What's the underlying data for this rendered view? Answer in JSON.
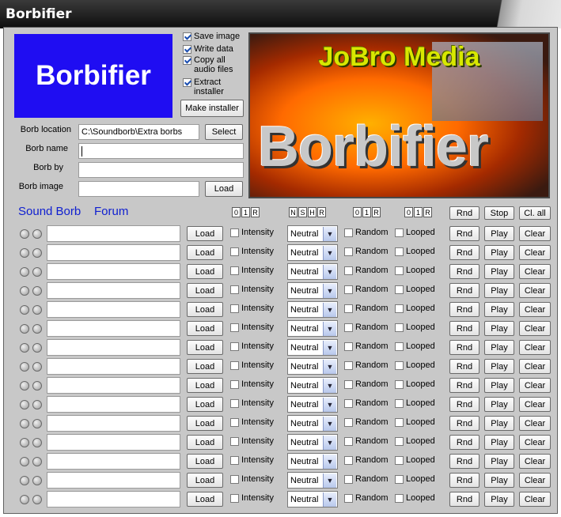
{
  "window": {
    "title": "Borbifier"
  },
  "logo": {
    "text": "Borbifier"
  },
  "options": {
    "save_image": {
      "label": "Save image",
      "checked": true
    },
    "write_data": {
      "label": "Write data",
      "checked": true
    },
    "copy_audio": {
      "label_1": "Copy all",
      "label_2": "audio files",
      "checked": true
    },
    "extract_installer": {
      "label_1": "Extract",
      "label_2": "installer",
      "checked": true
    },
    "make_installer": "Make installer"
  },
  "form": {
    "location_label": "Borb location",
    "location_value": "C:\\Soundborb\\Extra borbs",
    "select_button": "Select",
    "name_label": "Borb name",
    "name_value": "",
    "by_label": "Borb by",
    "by_value": "",
    "image_label": "Borb image",
    "image_value": "",
    "load_button": "Load"
  },
  "banner": {
    "company": "JoBro Media",
    "title": "Borbifier"
  },
  "links": {
    "sound_borb": "Sound Borb",
    "forum": "Forum"
  },
  "header": {
    "group1": [
      "0",
      "1",
      "R"
    ],
    "group2": [
      "N",
      "S",
      "H",
      "R"
    ],
    "group3": [
      "0",
      "1",
      "R"
    ],
    "group4": [
      "0",
      "1",
      "R"
    ],
    "rnd": "Rnd",
    "stop": "Stop",
    "clear_all": "Cl. all"
  },
  "rows": [
    {
      "load": "Load",
      "intensity": "Intensity",
      "mode": "Neutral",
      "random": "Random",
      "looped": "Looped",
      "rnd": "Rnd",
      "play": "Play",
      "clear": "Clear"
    },
    {
      "load": "Load",
      "intensity": "Intensity",
      "mode": "Neutral",
      "random": "Random",
      "looped": "Looped",
      "rnd": "Rnd",
      "play": "Play",
      "clear": "Clear"
    },
    {
      "load": "Load",
      "intensity": "Intensity",
      "mode": "Neutral",
      "random": "Random",
      "looped": "Looped",
      "rnd": "Rnd",
      "play": "Play",
      "clear": "Clear"
    },
    {
      "load": "Load",
      "intensity": "Intensity",
      "mode": "Neutral",
      "random": "Random",
      "looped": "Looped",
      "rnd": "Rnd",
      "play": "Play",
      "clear": "Clear"
    },
    {
      "load": "Load",
      "intensity": "Intensity",
      "mode": "Neutral",
      "random": "Random",
      "looped": "Looped",
      "rnd": "Rnd",
      "play": "Play",
      "clear": "Clear"
    },
    {
      "load": "Load",
      "intensity": "Intensity",
      "mode": "Neutral",
      "random": "Random",
      "looped": "Looped",
      "rnd": "Rnd",
      "play": "Play",
      "clear": "Clear"
    },
    {
      "load": "Load",
      "intensity": "Intensity",
      "mode": "Neutral",
      "random": "Random",
      "looped": "Looped",
      "rnd": "Rnd",
      "play": "Play",
      "clear": "Clear"
    },
    {
      "load": "Load",
      "intensity": "Intensity",
      "mode": "Neutral",
      "random": "Random",
      "looped": "Looped",
      "rnd": "Rnd",
      "play": "Play",
      "clear": "Clear"
    },
    {
      "load": "Load",
      "intensity": "Intensity",
      "mode": "Neutral",
      "random": "Random",
      "looped": "Looped",
      "rnd": "Rnd",
      "play": "Play",
      "clear": "Clear"
    },
    {
      "load": "Load",
      "intensity": "Intensity",
      "mode": "Neutral",
      "random": "Random",
      "looped": "Looped",
      "rnd": "Rnd",
      "play": "Play",
      "clear": "Clear"
    },
    {
      "load": "Load",
      "intensity": "Intensity",
      "mode": "Neutral",
      "random": "Random",
      "looped": "Looped",
      "rnd": "Rnd",
      "play": "Play",
      "clear": "Clear"
    },
    {
      "load": "Load",
      "intensity": "Intensity",
      "mode": "Neutral",
      "random": "Random",
      "looped": "Looped",
      "rnd": "Rnd",
      "play": "Play",
      "clear": "Clear"
    },
    {
      "load": "Load",
      "intensity": "Intensity",
      "mode": "Neutral",
      "random": "Random",
      "looped": "Looped",
      "rnd": "Rnd",
      "play": "Play",
      "clear": "Clear"
    },
    {
      "load": "Load",
      "intensity": "Intensity",
      "mode": "Neutral",
      "random": "Random",
      "looped": "Looped",
      "rnd": "Rnd",
      "play": "Play",
      "clear": "Clear"
    },
    {
      "load": "Load",
      "intensity": "Intensity",
      "mode": "Neutral",
      "random": "Random",
      "looped": "Looped",
      "rnd": "Rnd",
      "play": "Play",
      "clear": "Clear"
    }
  ],
  "colors": {
    "logo_bg": "#1f0df2",
    "link": "#1020d0",
    "panel": "#c8c8c8"
  }
}
